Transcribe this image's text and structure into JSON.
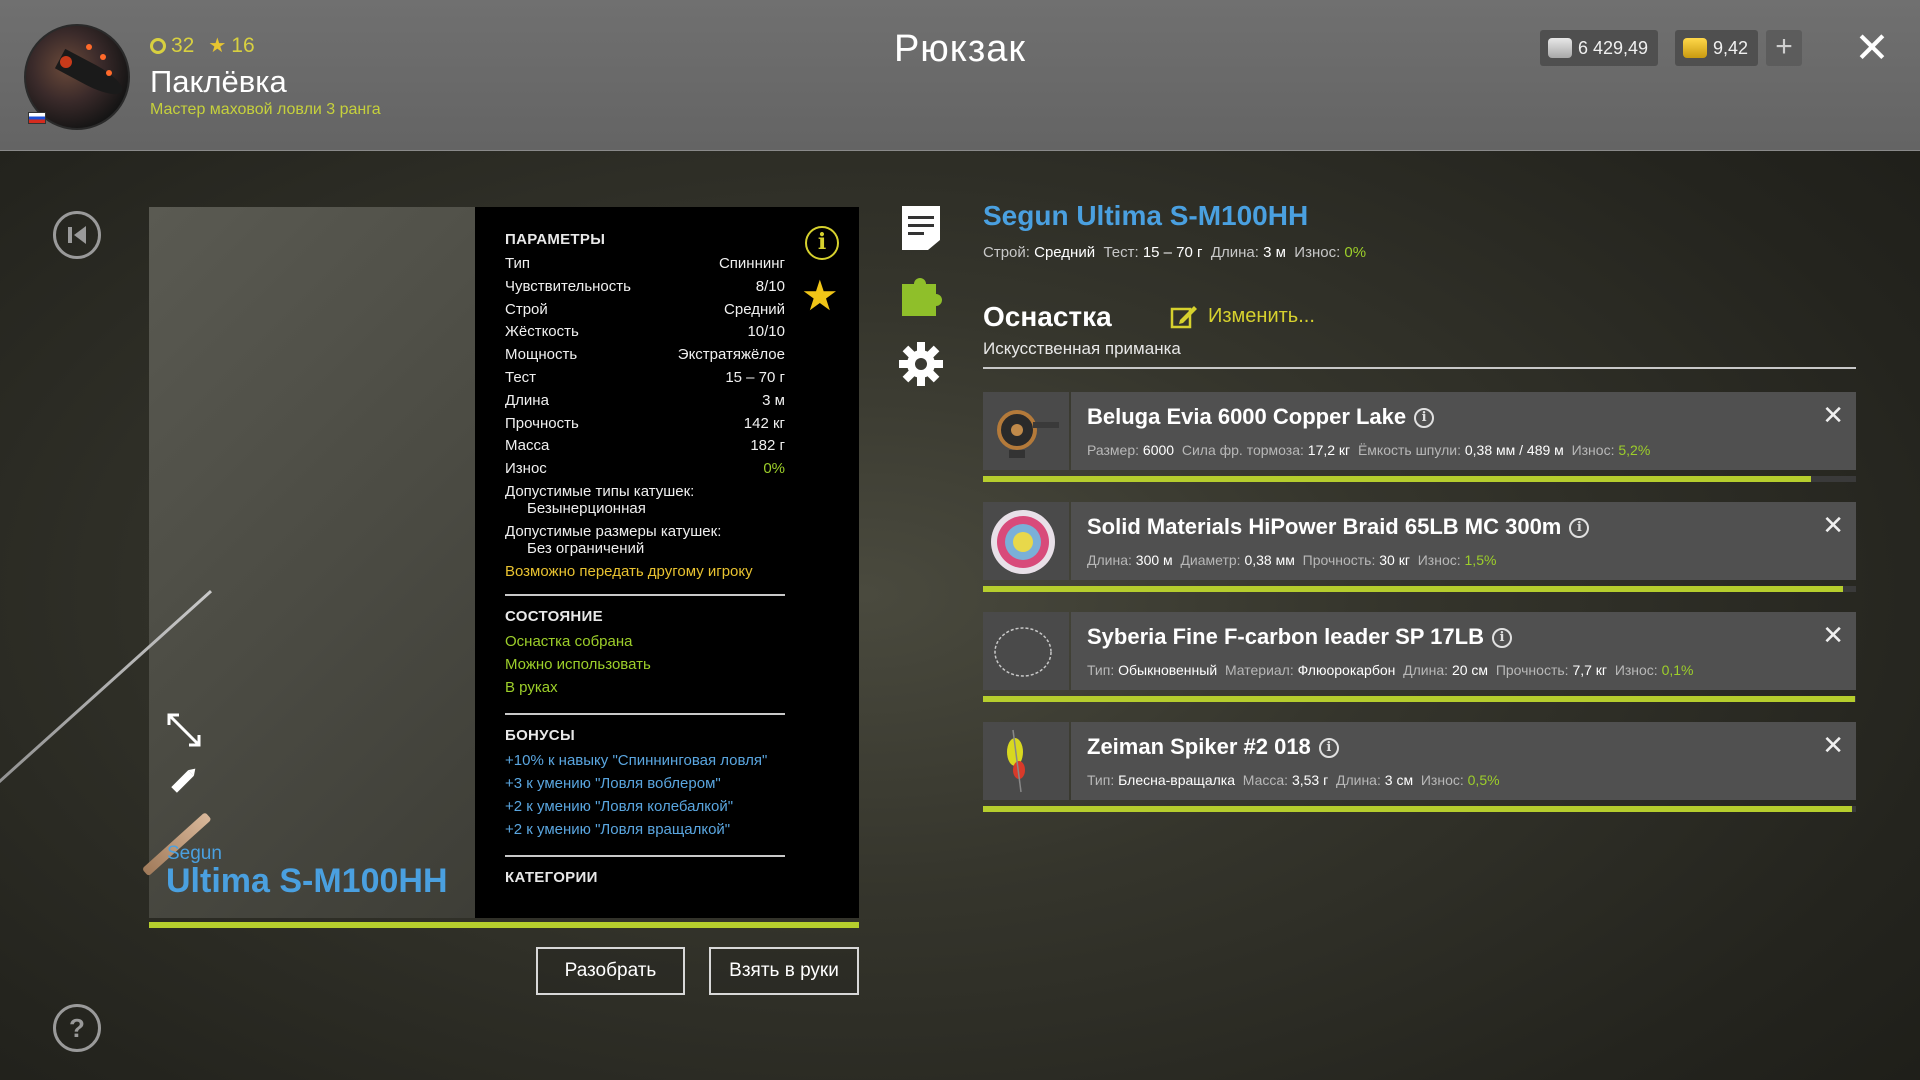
{
  "header": {
    "title": "Рюкзак",
    "player_name": "Паклёвка",
    "player_rank": "Мастер маховой ловли 3 ранга",
    "level": "32",
    "stars": "16",
    "silver": "6 429,49",
    "gold": "9,42",
    "plus_label": "+",
    "close_label": "✕"
  },
  "item": {
    "brand": "Segun",
    "model": "Ultima S-M100HH",
    "full_name": "Segun Ultima S-M100HH",
    "summary": {
      "build_label": "Строй:",
      "build_value": "Средний",
      "test_label": "Тест:",
      "test_value": "15 – 70 г",
      "length_label": "Длина:",
      "length_value": "3 м",
      "wear_label": "Износ:",
      "wear_value": "0%"
    }
  },
  "params": {
    "title": "ПАРАМЕТРЫ",
    "rows": [
      {
        "label": "Тип",
        "value": "Спиннинг"
      },
      {
        "label": "Чувствительность",
        "value": "8/10"
      },
      {
        "label": "Строй",
        "value": "Средний"
      },
      {
        "label": "Жёсткость",
        "value": "10/10"
      },
      {
        "label": "Мощность",
        "value": "Экстратяжёлое"
      },
      {
        "label": "Тест",
        "value": "15 – 70 г"
      },
      {
        "label": "Длина",
        "value": "3 м"
      },
      {
        "label": "Прочность",
        "value": "142 кг"
      },
      {
        "label": "Масса",
        "value": "182 г"
      },
      {
        "label": "Износ",
        "value": "0%"
      }
    ],
    "reel_types_label": "Допустимые типы катушек:",
    "reel_types_value": "Безынерционная",
    "reel_sizes_label": "Допустимые размеры катушек:",
    "reel_sizes_value": "Без ограничений",
    "transfer_note": "Возможно передать другому игроку",
    "state_title": "СОСТОЯНИЕ",
    "states": [
      "Оснастка собрана",
      "Можно использовать",
      "В руках"
    ],
    "bonus_title": "БОНУСЫ",
    "bonuses": [
      "+10% к навыку \"Спиннинговая ловля\"",
      "+3 к умению \"Ловля воблером\"",
      "+2 к умению \"Ловля колебалкой\"",
      "+2 к умению \"Ловля вращалкой\""
    ],
    "categories_title": "КАТЕГОРИИ"
  },
  "actions": {
    "disassemble": "Разобрать",
    "take_in_hands": "Взять в руки"
  },
  "rig": {
    "title": "Оснастка",
    "edit_label": "Изменить...",
    "type": "Искусственная приманка",
    "components": [
      {
        "name": "Beluga Evia 6000 Copper Lake",
        "specs": [
          {
            "label": "Размер:",
            "value": "6000"
          },
          {
            "label": "Сила фр. тормоза:",
            "value": "17,2 кг"
          },
          {
            "label": "Ёмкость шпули:",
            "value": "0,38 мм / 489 м"
          },
          {
            "label": "Износ:",
            "value": "5,2%",
            "green": true
          }
        ],
        "condition": 0.948
      },
      {
        "name": "Solid Materials HiPower Braid 65LB MC 300m",
        "specs": [
          {
            "label": "Длина:",
            "value": "300 м"
          },
          {
            "label": "Диаметр:",
            "value": "0,38 мм"
          },
          {
            "label": "Прочность:",
            "value": "30 кг"
          },
          {
            "label": "Износ:",
            "value": "1,5%",
            "green": true
          }
        ],
        "condition": 0.985
      },
      {
        "name": "Syberia Fine F-carbon leader SP 17LB",
        "specs": [
          {
            "label": "Тип:",
            "value": "Обыкновенный"
          },
          {
            "label": "Материал:",
            "value": "Флюорокарбон"
          },
          {
            "label": "Длина:",
            "value": "20 см"
          },
          {
            "label": "Прочность:",
            "value": "7,7 кг"
          },
          {
            "label": "Износ:",
            "value": "0,1%",
            "green": true
          }
        ],
        "condition": 0.999
      },
      {
        "name": "Zeiman Spiker #2 018",
        "specs": [
          {
            "label": "Тип:",
            "value": "Блесна-вращалка"
          },
          {
            "label": "Масса:",
            "value": "3,53 г"
          },
          {
            "label": "Длина:",
            "value": "3 см"
          },
          {
            "label": "Износ:",
            "value": "0,5%",
            "green": true
          }
        ],
        "condition": 0.995
      }
    ]
  },
  "colors": {
    "accent_blue": "#4aa0e0",
    "accent_green": "#9dcf2a",
    "accent_yellow": "#d6d12e",
    "bar_green": "#b6ce2d"
  }
}
